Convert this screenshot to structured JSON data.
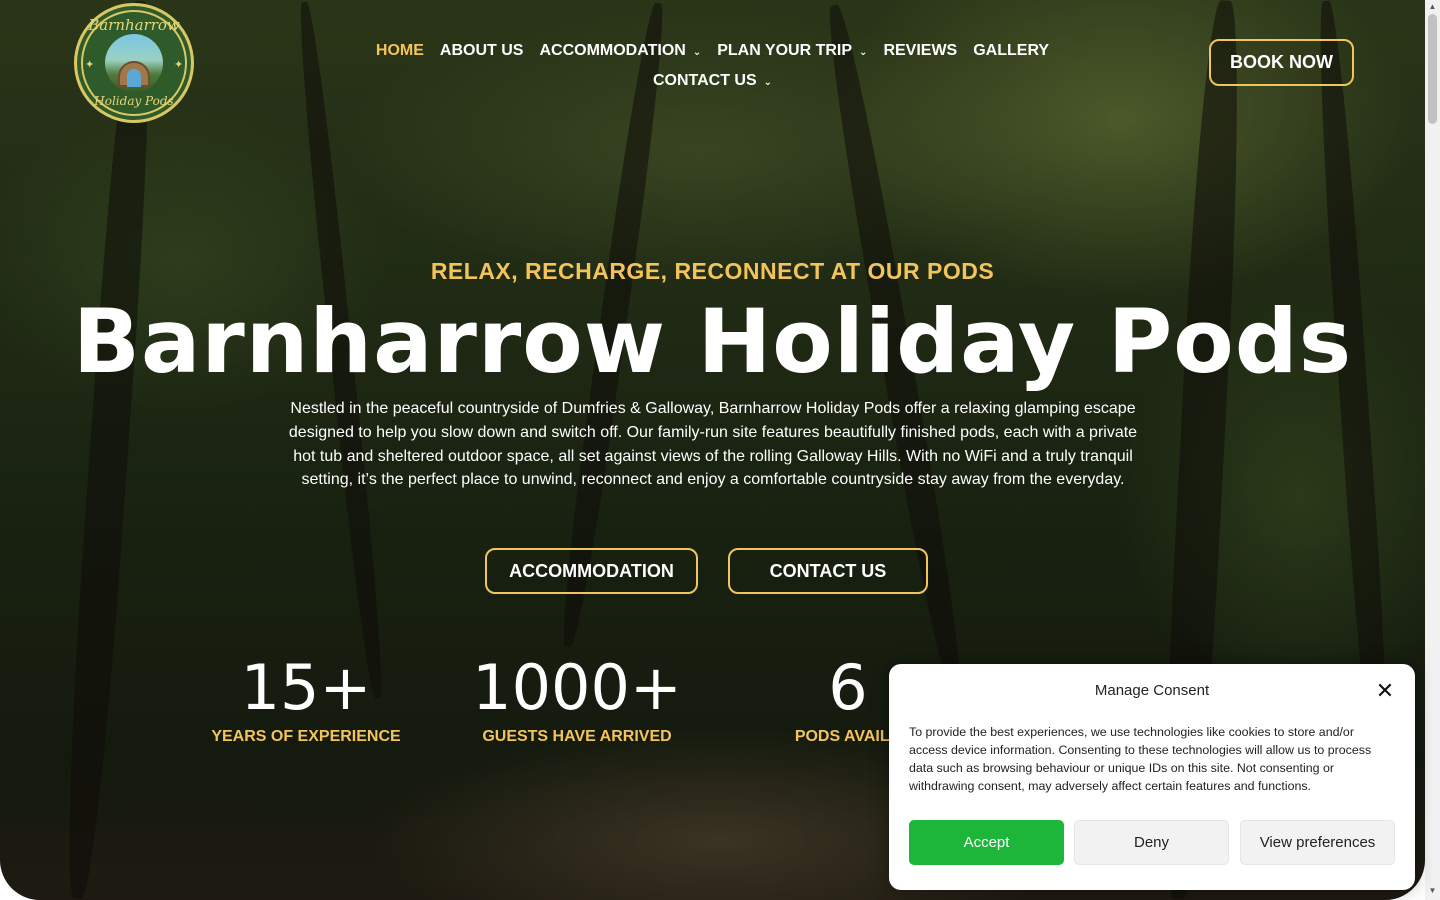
{
  "logo": {
    "text_top": "Barnharrow",
    "text_bottom": "Holiday Pods"
  },
  "nav": {
    "row1": [
      {
        "label": "HOME",
        "active": true,
        "dropdown": false
      },
      {
        "label": "ABOUT US",
        "active": false,
        "dropdown": false
      },
      {
        "label": "ACCOMMODATION",
        "active": false,
        "dropdown": true
      },
      {
        "label": "PLAN YOUR TRIP",
        "active": false,
        "dropdown": true
      },
      {
        "label": "REVIEWS",
        "active": false,
        "dropdown": false
      },
      {
        "label": "GALLERY",
        "active": false,
        "dropdown": false
      }
    ],
    "row2": [
      {
        "label": "CONTACT US",
        "active": false,
        "dropdown": true
      }
    ]
  },
  "header": {
    "book_button": "BOOK NOW"
  },
  "hero": {
    "tagline": "RELAX, RECHARGE, RECONNECT AT OUR PODS",
    "title": "Barnharrow Holiday Pods",
    "description": "Nestled in the peaceful countryside of Dumfries & Galloway, Barnharrow Holiday Pods offer a relaxing glamping escape designed to help you slow down and switch off. Our family-run site features beautifully finished pods, each with a private hot tub and sheltered outdoor space, all set against views of the rolling Galloway Hills. With no WiFi and a truly tranquil setting, it’s the perfect place to unwind, reconnect and enjoy a comfortable countryside stay away from the everyday.",
    "cta_primary": "ACCOMMODATION",
    "cta_secondary": "CONTACT US"
  },
  "stats": [
    {
      "number": "15+",
      "label": "YEARS OF EXPERIENCE"
    },
    {
      "number": "1000+",
      "label": "GUESTS HAVE ARRIVED"
    },
    {
      "number": "6",
      "label": "PODS AVAILA"
    },
    {
      "number": "",
      "label": ""
    }
  ],
  "consent": {
    "title": "Manage Consent",
    "close_icon": "close-icon",
    "text": "To provide the best experiences, we use technologies like cookies to store and/or access device information. Consenting to these technologies will allow us to process data such as browsing behaviour or unique IDs on this site. Not consenting or withdrawing consent, may adversely affect certain features and functions.",
    "accept": "Accept",
    "deny": "Deny",
    "preferences": "View preferences"
  },
  "colors": {
    "accent": "#f2c45b",
    "accept_green": "#1db53a"
  }
}
